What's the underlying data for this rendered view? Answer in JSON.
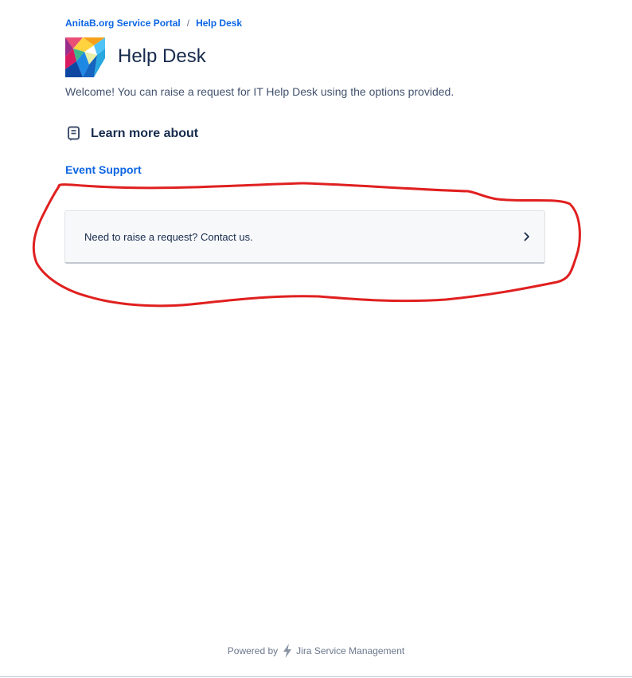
{
  "breadcrumb": {
    "portal": "AnitaB.org Service Portal",
    "separator": "/",
    "current": "Help Desk"
  },
  "header": {
    "title": "Help Desk",
    "logo_icon": "anitab-logo-icon"
  },
  "welcome_text": "Welcome! You can raise a request for IT Help Desk using the options provided.",
  "knowledge": {
    "heading": "Learn more about",
    "icon": "knowledge-base-icon",
    "link": "Event Support"
  },
  "contact": {
    "label": "Need to raise a request? Contact us.",
    "icon": "chevron-right-icon"
  },
  "footer": {
    "powered_by": "Powered by",
    "product": "Jira Service Management",
    "icon": "jira-bolt-icon"
  },
  "colors": {
    "link": "#0c66e4",
    "text": "#172b4d",
    "annotation": "#e02020"
  }
}
